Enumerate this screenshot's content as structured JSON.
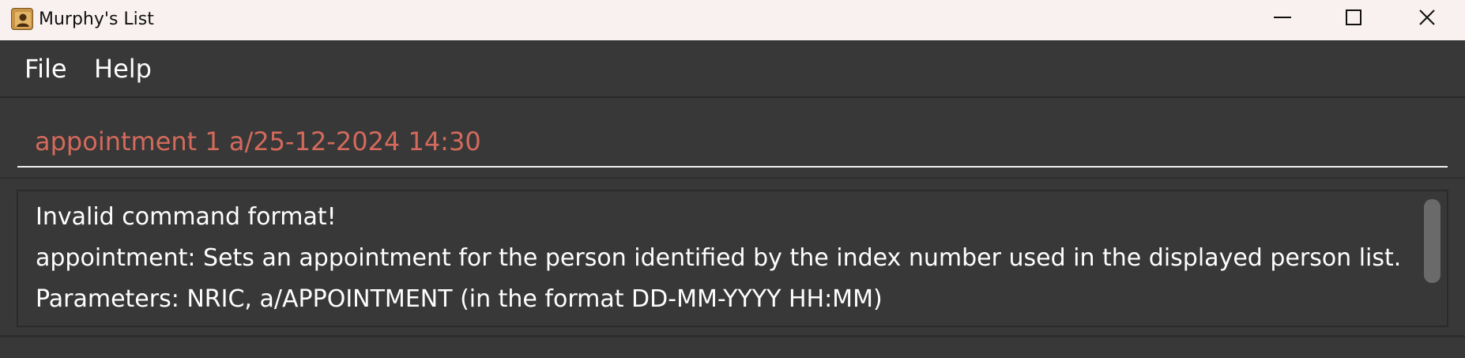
{
  "window": {
    "title": "Murphy's List",
    "controls": {
      "minimize_icon": "minimize-icon",
      "maximize_icon": "maximize-icon",
      "close_icon": "close-icon"
    }
  },
  "menu": {
    "items": [
      {
        "label": "File"
      },
      {
        "label": "Help"
      }
    ]
  },
  "command": {
    "value": "appointment 1 a/25-12-2024 14:30",
    "error_color": "#d36a5b"
  },
  "result": {
    "lines": [
      "Invalid command format!",
      "appointment: Sets an appointment for the person identified by the index number used in the displayed person list.",
      "Parameters: NRIC, a/APPOINTMENT (in the format DD-MM-YYYY HH:MM)"
    ]
  },
  "colors": {
    "background": "#383838",
    "titlebar": "#f8f1f0",
    "text": "#ffffff"
  }
}
